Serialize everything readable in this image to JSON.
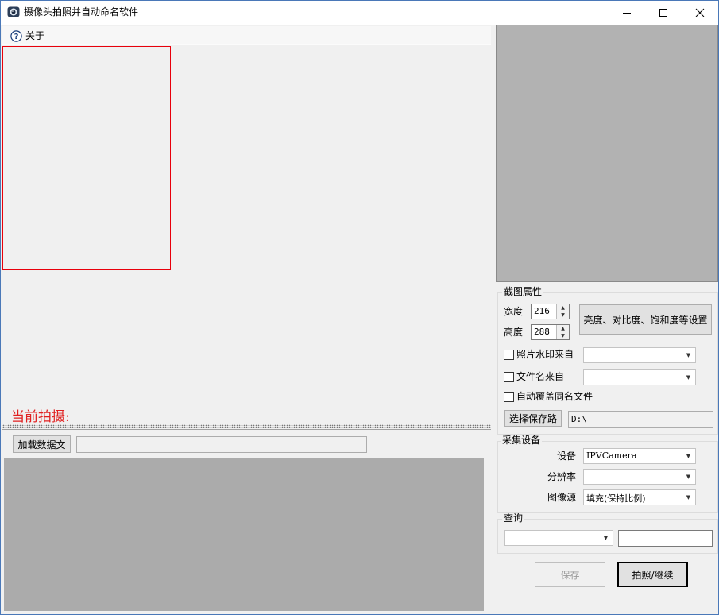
{
  "window": {
    "title": "摄像头拍照并自动命名软件"
  },
  "menu": {
    "about_label": "关于"
  },
  "capture": {
    "current_label": "当前拍摄:"
  },
  "data_file": {
    "load_button_label": "加载数据文",
    "path_value": ""
  },
  "crop_props": {
    "title": "截图属性",
    "width_label": "宽度",
    "width_value": "216",
    "height_label": "高度",
    "height_value": "288",
    "adjust_button_label": "亮度、对比度、饱和度等设置",
    "watermark_label": "照片水印来自",
    "watermark_value": "",
    "filename_label": "文件名来自",
    "filename_value": "",
    "overwrite_label": "自动覆盖同名文件",
    "choose_path_label": "选择保存路",
    "save_path_value": "D:\\"
  },
  "device_group": {
    "title": "采集设备",
    "device_label": "设备",
    "device_value": "IPVCamera",
    "resolution_label": "分辨率",
    "resolution_value": "",
    "image_source_label": "图像源",
    "image_source_value": "填充(保持比例)"
  },
  "query_group": {
    "title": "查询",
    "field_value": "",
    "query_text": ""
  },
  "actions": {
    "save_label": "保存",
    "capture_label": "拍照/继续"
  }
}
